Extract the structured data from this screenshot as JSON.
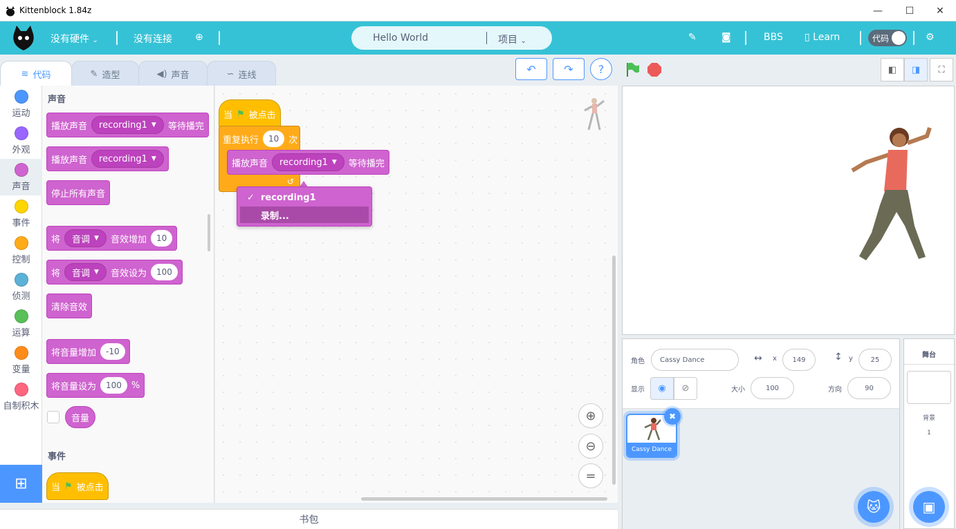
{
  "window": {
    "title": "Kittenblock 1.84z",
    "minimize": "—",
    "maximize": "☐",
    "close": "✕"
  },
  "menubar": {
    "hardware": "没有硬件",
    "connection": "没有连接",
    "project_name": "Hello World",
    "project_menu": "项目",
    "bbs": "BBS",
    "learn": "Learn",
    "code_toggle": "代码"
  },
  "tabs": [
    {
      "label": "代码"
    },
    {
      "label": "造型"
    },
    {
      "label": "声音"
    },
    {
      "label": "连线"
    }
  ],
  "categories": [
    {
      "label": "运动",
      "color": "#4c97ff"
    },
    {
      "label": "外观",
      "color": "#9966ff"
    },
    {
      "label": "声音",
      "color": "#cf63cf"
    },
    {
      "label": "事件",
      "color": "#ffd500"
    },
    {
      "label": "控制",
      "color": "#ffab19"
    },
    {
      "label": "侦测",
      "color": "#5cb1d6"
    },
    {
      "label": "运算",
      "color": "#59c059"
    },
    {
      "label": "变量",
      "color": "#ff8c1a"
    },
    {
      "label": "自制积木",
      "color": "#ff6680"
    }
  ],
  "palette": {
    "sound_heading": "声音",
    "play_wait": {
      "a": "播放声音",
      "sound": "recording1",
      "b": "等待播完"
    },
    "play": {
      "a": "播放声音",
      "sound": "recording1"
    },
    "stop_all": "停止所有声音",
    "change_effect": {
      "a": "将",
      "effect": "音调",
      "b": "音效增加",
      "val": "10"
    },
    "set_effect": {
      "a": "将",
      "effect": "音调",
      "b": "音效设为",
      "val": "100"
    },
    "clear_effects": "清除音效",
    "change_volume": {
      "a": "将音量增加",
      "val": "-10"
    },
    "set_volume": {
      "a": "将音量设为",
      "val": "100",
      "unit": "%"
    },
    "volume_reporter": "音量",
    "events_heading": "事件",
    "when_flag": {
      "a": "当",
      "b": "被点击"
    }
  },
  "script": {
    "hat": {
      "a": "当",
      "b": "被点击"
    },
    "repeat": {
      "a": "重复执行",
      "val": "10",
      "b": "次"
    },
    "play": {
      "a": "播放声音",
      "sound": "recording1",
      "b": "等待播完"
    },
    "dropdown": [
      "recording1",
      "录制..."
    ]
  },
  "bag": "书包",
  "sprite": {
    "label_sprite": "角色",
    "name": "Cassy Dance",
    "x_label": "x",
    "x": "149",
    "y_label": "y",
    "y": "25",
    "show_label": "显示",
    "size_label": "大小",
    "size": "100",
    "direction_label": "方向",
    "direction": "90",
    "thumb_name": "Cassy Dance"
  },
  "stage_panel": {
    "title": "舞台",
    "backdrop_label": "背景",
    "backdrop_count": "1"
  }
}
